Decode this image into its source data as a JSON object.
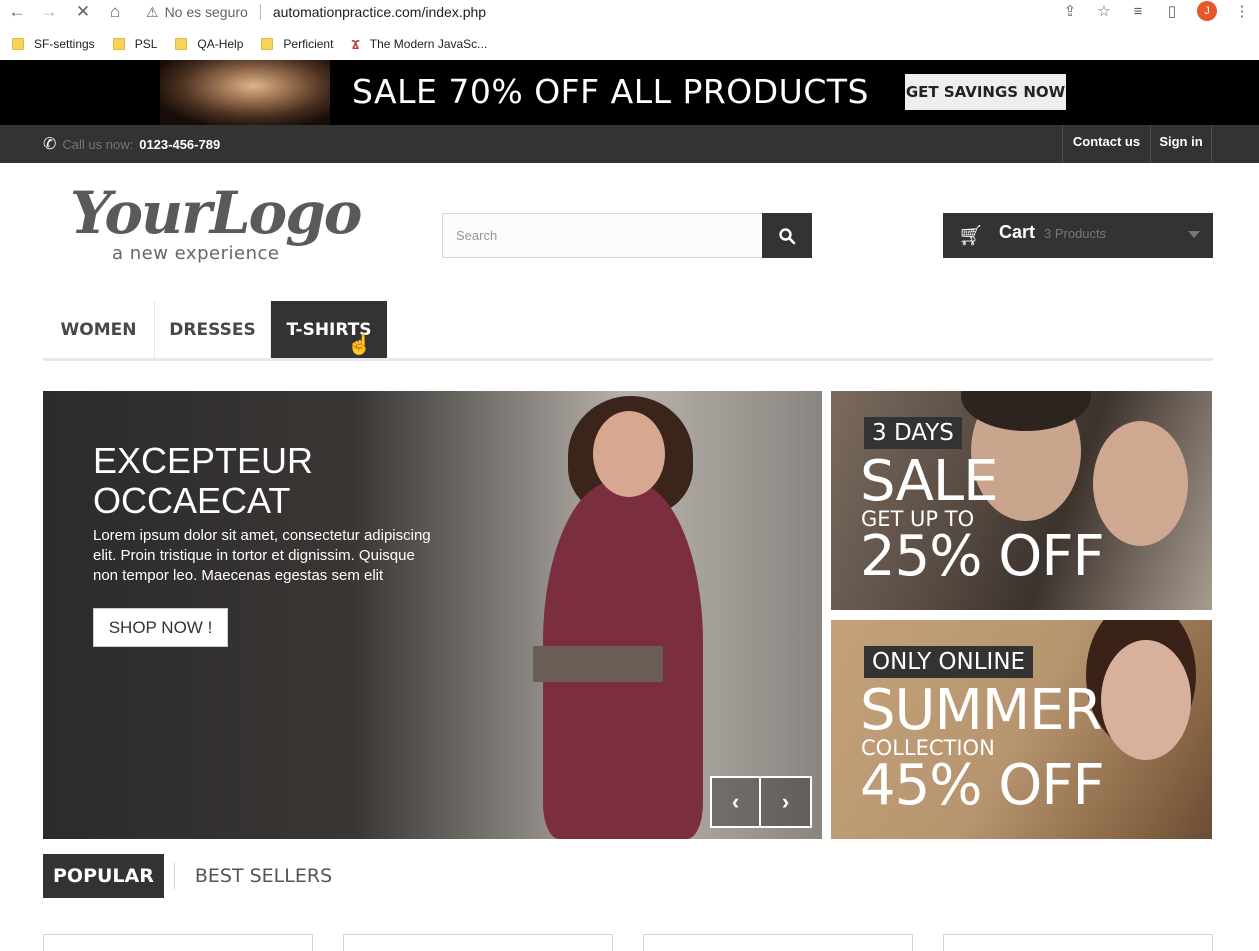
{
  "browser": {
    "security_label": "No es seguro",
    "url": "automationpractice.com/index.php",
    "avatar_initial": "J",
    "bookmarks": [
      {
        "label": "SF-settings"
      },
      {
        "label": "PSL"
      },
      {
        "label": "QA-Help"
      },
      {
        "label": "Perficient"
      },
      {
        "label": "The Modern JavaSc..."
      }
    ]
  },
  "banner": {
    "text": "SALE 70% OFF ALL PRODUCTS",
    "button": "GET SAVINGS NOW"
  },
  "topnav": {
    "call_label": "Call us now:",
    "phone": "0123-456-789",
    "contact": "Contact us",
    "signin": "Sign in"
  },
  "header": {
    "logo_script": "YourLogo",
    "logo_tagline": "a new experience",
    "search_placeholder": "Search",
    "cart_label": "Cart",
    "cart_count": "3 Products"
  },
  "menu": {
    "items": [
      "WOMEN",
      "DRESSES",
      "T-SHIRTS"
    ],
    "active": "T-SHIRTS"
  },
  "slider": {
    "title_line1": "EXCEPTEUR",
    "title_line2": "OCCAECAT",
    "text": "Lorem ipsum dolor sit amet, consectetur adipiscing elit. Proin tristique in tortor et dignissim. Quisque non tempor leo. Maecenas egestas sem elit",
    "button": "SHOP NOW !"
  },
  "promos": [
    {
      "label": "3 DAYS",
      "big": "SALE",
      "small": "GET UP TO",
      "discount": "25% OFF"
    },
    {
      "label": "ONLY ONLINE",
      "big": "SUMMER",
      "small": "COLLECTION",
      "discount": "45% OFF"
    }
  ],
  "tabs": {
    "popular": "POPULAR",
    "best_sellers": "BEST SELLERS"
  },
  "colors": {
    "dark": "#333333",
    "accent_orange": "#e8572a"
  }
}
